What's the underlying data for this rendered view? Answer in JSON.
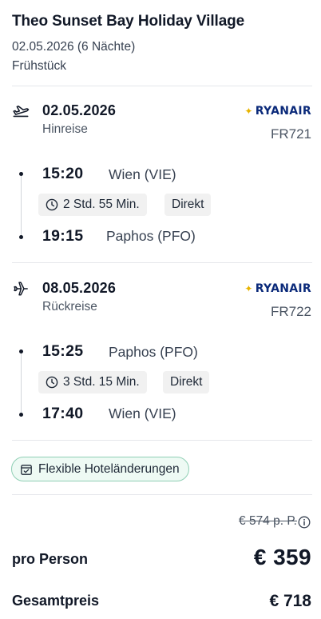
{
  "hotel": {
    "title": "Theo Sunset Bay Holiday Village",
    "dates": "02.05.2026 (6 Nächte)",
    "board": "Frühstück"
  },
  "outbound": {
    "icon": "plane-departure-icon",
    "date": "02.05.2026",
    "direction": "Hinreise",
    "airline": "RYANAIR",
    "flight_number": "FR721",
    "departure_time": "15:20",
    "departure_airport": "Wien (VIE)",
    "duration": "2 Std. 55 Min.",
    "stops": "Direkt",
    "arrival_time": "19:15",
    "arrival_airport": "Paphos (PFO)"
  },
  "return": {
    "icon": "plane-arrival-icon",
    "date": "08.05.2026",
    "direction": "Rückreise",
    "airline": "RYANAIR",
    "flight_number": "FR722",
    "departure_time": "15:25",
    "departure_airport": "Paphos (PFO)",
    "duration": "3 Std. 15 Min.",
    "stops": "Direkt",
    "arrival_time": "17:40",
    "arrival_airport": "Wien (VIE)"
  },
  "flex_badge": "Flexible Hoteländerungen",
  "pricing": {
    "old_price": "€ 574 p. P.",
    "per_person_label": "pro Person",
    "per_person_value": "€ 359",
    "total_label": "Gesamtpreis",
    "total_value": "€ 718"
  },
  "colors": {
    "airline_blue": "#0b2a7a",
    "airline_gold": "#e8b400",
    "badge_border": "#8fcfb4",
    "badge_bg": "#eefaf4"
  }
}
